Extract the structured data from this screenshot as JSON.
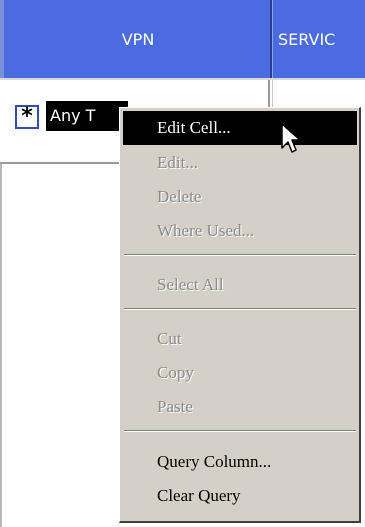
{
  "table": {
    "columns": [
      {
        "label": "VPN"
      },
      {
        "label": "SERVIC"
      }
    ],
    "row": {
      "star_icon": "*",
      "cell_text": "Any T"
    }
  },
  "context_menu": {
    "items": [
      {
        "label": "Edit Cell...",
        "state": "selected"
      },
      {
        "label": "Edit...",
        "state": "disabled"
      },
      {
        "label": "Delete",
        "state": "disabled"
      },
      {
        "label": "Where Used...",
        "state": "disabled"
      },
      {
        "label": "Select All",
        "state": "disabled"
      },
      {
        "label": "Cut",
        "state": "disabled"
      },
      {
        "label": "Copy",
        "state": "disabled"
      },
      {
        "label": "Paste",
        "state": "disabled"
      },
      {
        "label": "Query Column...",
        "state": "enabled"
      },
      {
        "label": "Clear Query",
        "state": "enabled"
      }
    ]
  },
  "icons": {
    "cursor": "mouse-pointer-icon",
    "star": "asterisk-icon"
  },
  "colors": {
    "header_bg": "#4a6ce0",
    "menu_bg": "#d4d0c8",
    "selection_bg": "#000000"
  }
}
